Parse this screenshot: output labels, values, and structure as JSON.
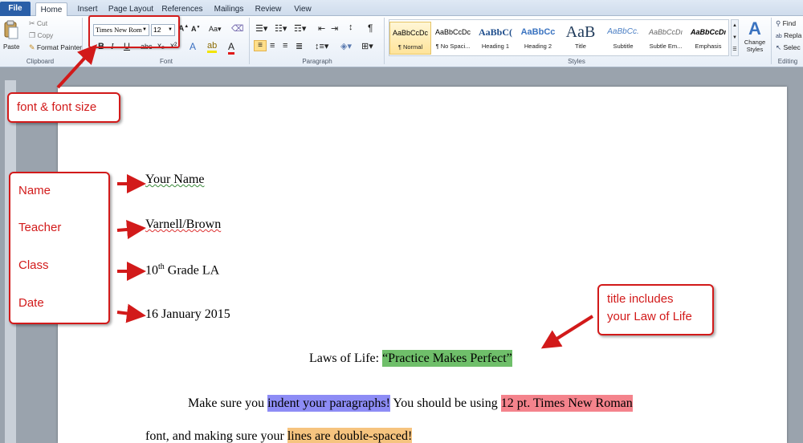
{
  "ribbon": {
    "tabs": [
      "File",
      "Home",
      "Insert",
      "Page Layout",
      "References",
      "Mailings",
      "Review",
      "View"
    ],
    "active_tab": "Home",
    "clipboard": {
      "paste": "Paste",
      "cut": "Cut",
      "copy": "Copy",
      "format_painter": "Format Painter",
      "group": "Clipboard"
    },
    "font": {
      "name": "Times New Rom",
      "size": "12",
      "group": "Font"
    },
    "paragraph": {
      "group": "Paragraph"
    },
    "styles": {
      "group": "Styles",
      "items": [
        {
          "preview": "AaBbCcDc",
          "name": "¶ Normal"
        },
        {
          "preview": "AaBbCcDc",
          "name": "¶ No Spaci..."
        },
        {
          "preview": "AaBbC(",
          "name": "Heading 1"
        },
        {
          "preview": "AaBbCc",
          "name": "Heading 2"
        },
        {
          "preview": "AaB",
          "name": "Title"
        },
        {
          "preview": "AaBbCc.",
          "name": "Subtitle"
        },
        {
          "preview": "AaBbCcDı",
          "name": "Subtle Em..."
        },
        {
          "preview": "AaBbCcDı",
          "name": "Emphasis"
        }
      ],
      "change_styles": "Change Styles"
    },
    "editing": {
      "find": "Find",
      "replace": "Repla",
      "select": "Selec",
      "group": "Editing"
    }
  },
  "document": {
    "name": "Your Name",
    "teacher": "Varnell/Brown",
    "class_prefix": "10",
    "class_sup": "th",
    "class_suffix": " Grade LA",
    "date": "16 January 2015",
    "title_prefix": "Laws of Life: ",
    "title_hl": "“Practice Makes Perfect”",
    "para1_a": "Make sure you ",
    "para1_hl1": "indent your paragraphs!",
    "para1_b": " You should be using ",
    "para1_hl2": "12 pt. Times New Roman",
    "para2_a": "font, and making sure your ",
    "para2_hl": "lines are double-spaced!"
  },
  "annotations": {
    "font_note": "font & font size",
    "heading_labels": [
      "Name",
      "Teacher",
      "Class",
      "Date"
    ],
    "title_note_line1": "title includes",
    "title_note_line2": "your Law of Life"
  },
  "colors": {
    "accent_red": "#d21a1a",
    "file_tab": "#2a5fa8"
  }
}
